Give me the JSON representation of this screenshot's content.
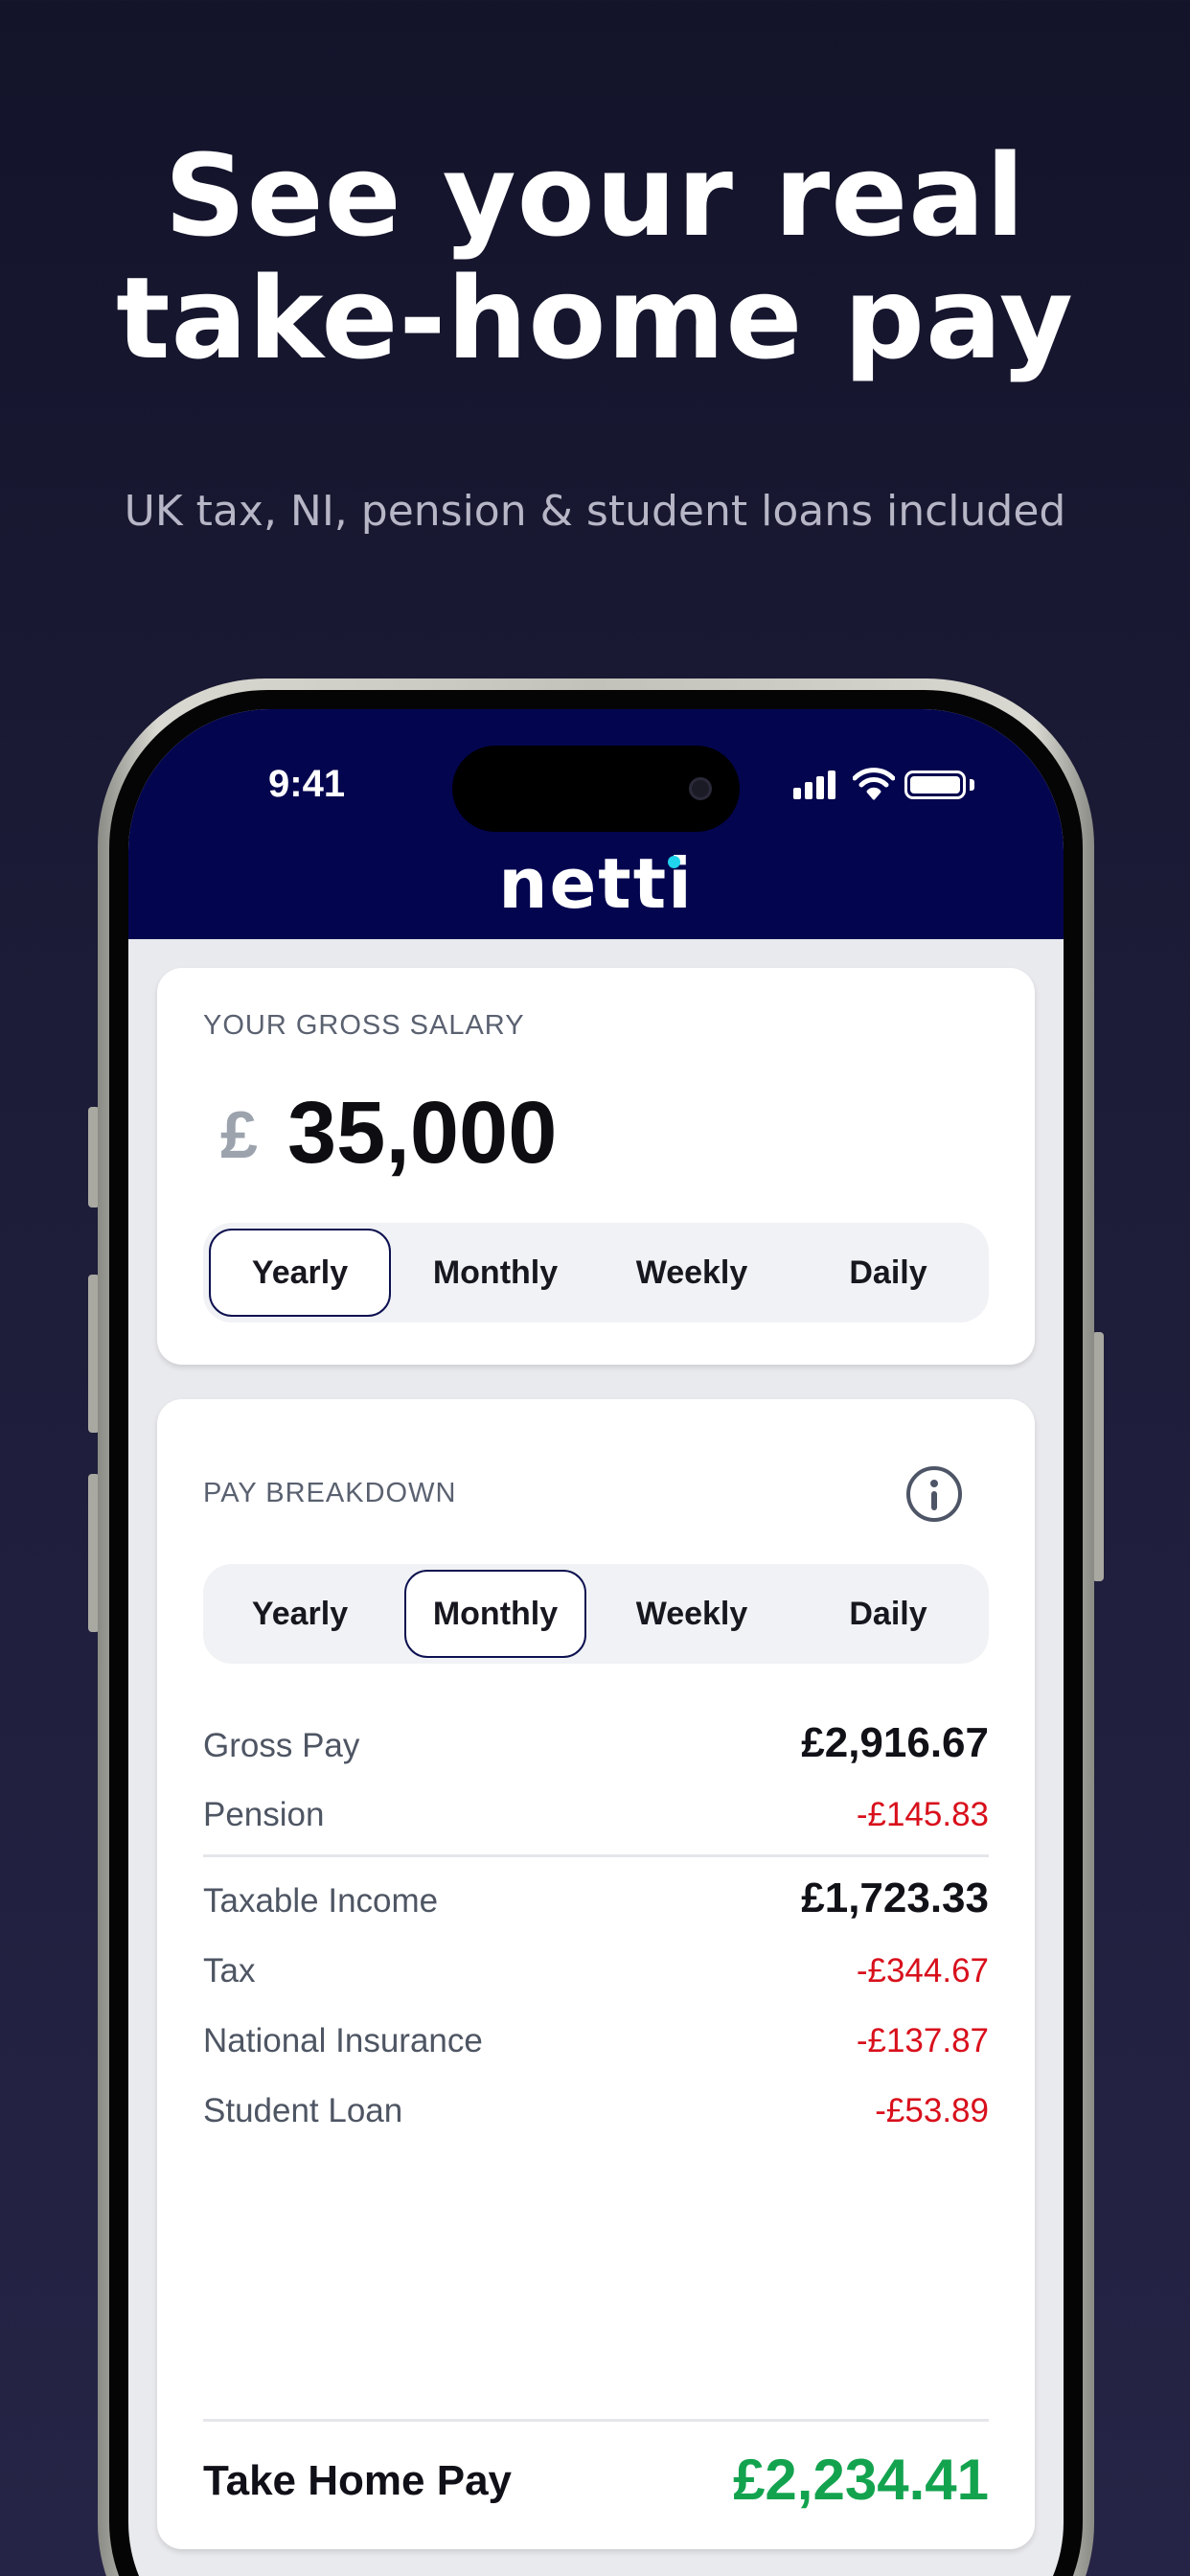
{
  "promo": {
    "headline_line1": "See your real",
    "headline_line2": "take-home pay",
    "subheadline": "UK tax, NI, pension & student loans included"
  },
  "status_bar": {
    "time": "9:41",
    "icons": [
      "cellular-signal-icon",
      "wifi-icon",
      "battery-icon"
    ]
  },
  "app": {
    "brand": "netti",
    "brand_color": "#04054f",
    "brand_dot_color": "#20d3ee"
  },
  "salary_card": {
    "label": "YOUR GROSS SALARY",
    "currency_symbol": "£",
    "salary_value": "35,000",
    "period_options": [
      "Yearly",
      "Monthly",
      "Weekly",
      "Daily"
    ],
    "selected_period": "Yearly"
  },
  "breakdown_card": {
    "label": "PAY BREAKDOWN",
    "info_icon": "info-icon",
    "period_options": [
      "Yearly",
      "Monthly",
      "Weekly",
      "Daily"
    ],
    "selected_period": "Monthly",
    "rows": [
      {
        "label": "Gross Pay",
        "value": "£2,916.67",
        "style": "total"
      },
      {
        "label": "Pension",
        "value": "-£145.83",
        "style": "deduction"
      },
      {
        "label": "Taxable Income",
        "value": "£1,723.33",
        "style": "total"
      },
      {
        "label": "Tax",
        "value": "-£344.67",
        "style": "deduction"
      },
      {
        "label": "National Insurance",
        "value": "-£137.87",
        "style": "deduction"
      },
      {
        "label": "Student Loan",
        "value": "-£53.89",
        "style": "deduction"
      }
    ],
    "take_home": {
      "label": "Take Home Pay",
      "value": "£2,234.41",
      "color": "#13a34f"
    },
    "deduction_color": "#d8101c"
  }
}
